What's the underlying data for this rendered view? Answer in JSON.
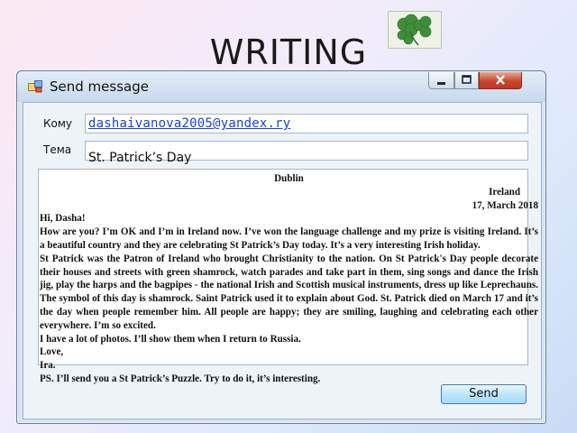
{
  "slide": {
    "title": "WRITING"
  },
  "window": {
    "title": "Send message"
  },
  "form": {
    "to_label": "Кому",
    "to_value": "dashaivanova2005@yandex.ry",
    "subject_label": "Тема",
    "subject_value": "St. Patrick’s Day"
  },
  "letter": {
    "city": "Dublin",
    "country": "Ireland",
    "date": "17, March 2018",
    "greeting": "Hi, Dasha!",
    "p1": "How are you? I’m OK and I’m in Ireland now. I’ve won the language challenge and my prize is visiting Ireland. It’s a beautiful country and they are celebrating St Patrick’s Day today. It’s a very interesting Irish holiday.",
    "p2": "St Patrick was the Patron of Ireland who brought Christianity to the nation. On St Patrick's Day people decorate their houses and streets with green shamrock, watch parades and take part in them, sing songs and dance the Irish jig, play the harps and the bagpipes - the national Irish and Scottish musical instruments, dress up like Leprechauns. The symbol of this day is shamrock. Saint Patrick used it to explain about God. St. Patrick died on March 17 and it’s the day when people remember him. All people are happy; they are smiling, laughing and celebrating each other everywhere. I’m so excited.",
    "p3": "I have a lot of photos. I’ll show them when I return to Russia.",
    "closing": "Love,",
    "signature": "Ira.",
    "ps": "PS. I’ll send you a St Patrick’s Puzzle. Try to do it, it’s interesting."
  },
  "actions": {
    "send_label": "Send"
  },
  "icons": {
    "window_icon": "envelope-app-icon",
    "minimize": "minimize-icon",
    "maximize": "maximize-icon",
    "close": "close-icon",
    "decor": "shamrock-icon"
  },
  "colors": {
    "link": "#1a3fd8",
    "close_button": "#c9462f",
    "titlebar": "#c8d9ec"
  }
}
